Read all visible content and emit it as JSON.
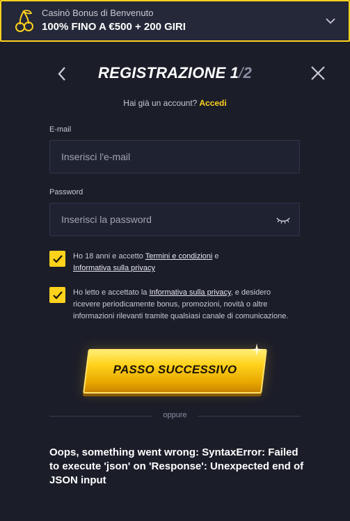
{
  "banner": {
    "icon": "cherry-icon",
    "subtitle": "Casinò Bonus di Benvenuto",
    "title": "100% FINO A €500 + 200 GIRI",
    "accent": "#ffd21c"
  },
  "header": {
    "title": "REGISTRAZIONE 1",
    "step_sep": "/",
    "step_total": "2"
  },
  "login": {
    "prompt": "Hai già un account?",
    "link": "Accedi"
  },
  "form": {
    "email_label": "E-mail",
    "email_placeholder": "Inserisci l'e-mail",
    "password_label": "Password",
    "password_placeholder": "Inserisci la password"
  },
  "consents": {
    "age_a": "Ho 18 anni e accetto ",
    "age_terms": "Termini e condizioni",
    "age_b": " e ",
    "age_privacy": "Informativa sulla privacy",
    "mkt_a": "Ho letto e accettato la ",
    "mkt_privacy": "Informativa sulla privacy",
    "mkt_b": ", e desidero ricevere periodicamente bonus, promozioni, novità o altre informazioni rilevanti tramite qualsiasi canale di comunicazione."
  },
  "cta": {
    "label": "PASSO SUCCESSIVO"
  },
  "separator": {
    "label": "oppure"
  },
  "error": {
    "message": "Oops, something went wrong: SyntaxError: Failed to execute 'json' on 'Response': Unexpected end of JSON input"
  }
}
